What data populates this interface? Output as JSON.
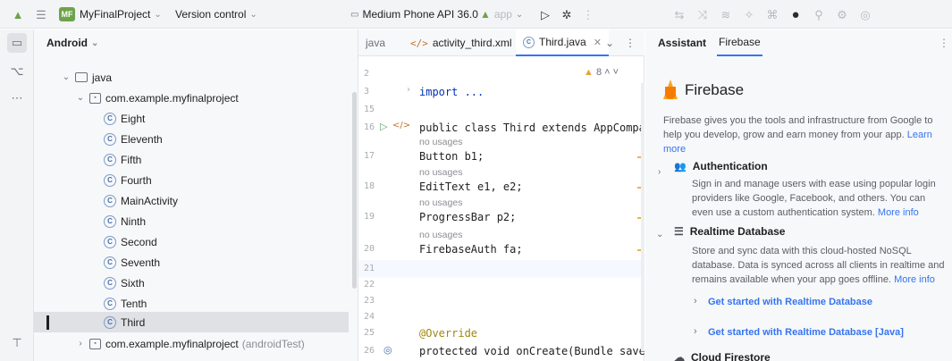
{
  "topbar": {
    "project_initials": "MF",
    "project_name": "MyFinalProject",
    "vcs_label": "Version control",
    "device": "Medium Phone API 36.0",
    "run_config": "app"
  },
  "project_panel": {
    "view_label": "Android",
    "tree": [
      {
        "label": "java",
        "kind": "folder",
        "level": 1
      },
      {
        "label": "com.example.myfinalproject",
        "kind": "package",
        "level": 2
      },
      {
        "label": "Eight",
        "kind": "class",
        "level": 3
      },
      {
        "label": "Eleventh",
        "kind": "class",
        "level": 3
      },
      {
        "label": "Fifth",
        "kind": "class",
        "level": 3
      },
      {
        "label": "Fourth",
        "kind": "class",
        "level": 3
      },
      {
        "label": "MainActivity",
        "kind": "class",
        "level": 3
      },
      {
        "label": "Ninth",
        "kind": "class",
        "level": 3
      },
      {
        "label": "Second",
        "kind": "class",
        "level": 3
      },
      {
        "label": "Seventh",
        "kind": "class",
        "level": 3
      },
      {
        "label": "Sixth",
        "kind": "class",
        "level": 3
      },
      {
        "label": "Tenth",
        "kind": "class",
        "level": 3
      },
      {
        "label": "Third",
        "kind": "class",
        "level": 3
      },
      {
        "label": "com.example.myfinalproject",
        "suffix": "(androidTest)",
        "kind": "package",
        "level": 2
      }
    ]
  },
  "editor": {
    "tabs": [
      {
        "label": "java"
      },
      {
        "label": "activity_third.xml"
      },
      {
        "label": "Third.java"
      }
    ],
    "warning_count": "8",
    "lines": [
      {
        "num": "2",
        "code": ""
      },
      {
        "num": "3",
        "code": "import ..."
      },
      {
        "num": "15",
        "code": ""
      },
      {
        "num": "16",
        "code": "public class Third extends AppCompatAct"
      },
      {
        "num": "17",
        "hint": "no usages",
        "code": "Button b1;"
      },
      {
        "num": "18",
        "hint": "no usages",
        "code": "EditText e1, e2;"
      },
      {
        "num": "19",
        "hint": "no usages",
        "code": "ProgressBar p2;"
      },
      {
        "num": "20",
        "hint": "no usages",
        "code": "FirebaseAuth fa;"
      },
      {
        "num": "21",
        "code": ""
      },
      {
        "num": "22",
        "code": ""
      },
      {
        "num": "23",
        "code": ""
      },
      {
        "num": "24",
        "code": ""
      },
      {
        "num": "25",
        "code": "@Override"
      },
      {
        "num": "26",
        "code": "protected void onCreate(Bundle save"
      }
    ]
  },
  "assistant": {
    "tab_assistant": "Assistant",
    "tab_firebase": "Firebase",
    "title": "Firebase",
    "intro": "Firebase gives you the tools and infrastructure from Google to help you develop, grow and earn money from your app.",
    "intro_link": "Learn more",
    "auth_title": "Authentication",
    "auth_desc": "Sign in and manage users with ease using popular login providers like Google, Facebook, and others. You can even use a custom authentication system.",
    "auth_link": "More info",
    "db_title": "Realtime Database",
    "db_desc": "Store and sync data with this cloud-hosted NoSQL database. Data is synced across all clients in realtime and remains available when your app goes offline.",
    "db_link": "More info",
    "get_started_1": "Get started with Realtime Database",
    "get_started_2": "Get started with Realtime Database [Java]",
    "next_section": "Cloud Firestore"
  },
  "colors": {
    "accent": "#3574f0",
    "project_badge": "#6ea34a",
    "firebase": "#f6a623"
  }
}
